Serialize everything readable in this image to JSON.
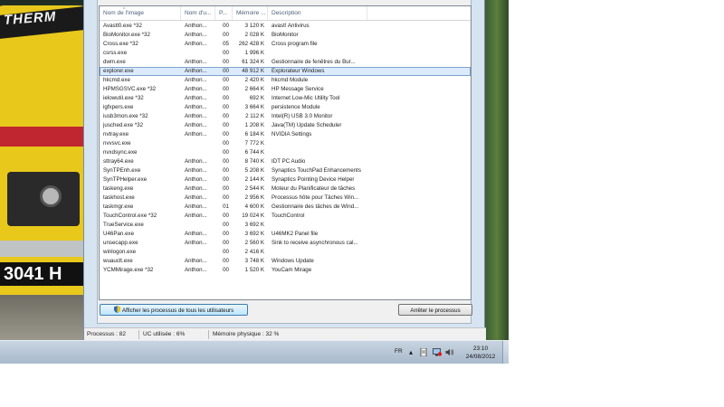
{
  "wallpaper": {
    "brand_text": "THERM",
    "plate_text": "3041 H"
  },
  "columns": [
    "Nom de l'image",
    "Nom d'u...",
    "P...",
    "Mémoire ...",
    "Description"
  ],
  "processes": [
    [
      "Avastl0.exe *32",
      "Anthon...",
      "00",
      "3 120 K",
      "avast! Antivirus"
    ],
    [
      "BioMonitor.exe *32",
      "Anthon...",
      "00",
      "2 028 K",
      "BioMonitor"
    ],
    [
      "Cross.exe *32",
      "Anthon...",
      "05",
      "262 428 K",
      "Cross program file"
    ],
    [
      "csrss.exe",
      "",
      "00",
      "1 996 K",
      ""
    ],
    [
      "dwm.exe",
      "Anthon...",
      "00",
      "61 324 K",
      "Gestionnaire de fenêtres du Bur..."
    ],
    [
      "explorer.exe",
      "Anthon...",
      "00",
      "48 912 K",
      "Explorateur Windows"
    ],
    [
      "hkcmd.exe",
      "Anthon...",
      "00",
      "2 420 K",
      "hkcmd Module"
    ],
    [
      "HPMSGSVC.exe *32",
      "Anthon...",
      "00",
      "2 664 K",
      "HP Message Service"
    ],
    [
      "ielowutil.exe *32",
      "Anthon...",
      "00",
      "692 K",
      "Internet Low-Mic Utility Tool"
    ],
    [
      "igfxpers.exe",
      "Anthon...",
      "00",
      "3 664 K",
      "persistence Module"
    ],
    [
      "iusb3mon.exe *32",
      "Anthon...",
      "00",
      "2 112 K",
      "Intel(R) USB 3.0 Monitor"
    ],
    [
      "jusched.exe *32",
      "Anthon...",
      "00",
      "1 208 K",
      "Java(TM) Update Scheduler"
    ],
    [
      "nvtray.exe",
      "Anthon...",
      "00",
      "6 184 K",
      "NVIDIA Settings"
    ],
    [
      "nvvsvc.exe",
      "",
      "00",
      "7 772 K",
      ""
    ],
    [
      "nvxdsync.exe",
      "",
      "00",
      "6 744 K",
      ""
    ],
    [
      "sttray64.exe",
      "Anthon...",
      "00",
      "8 740 K",
      "IDT PC Audio"
    ],
    [
      "SynTPEnh.exe",
      "Anthon...",
      "00",
      "5 208 K",
      "Synaptics TouchPad Enhancements"
    ],
    [
      "SynTPHelper.exe",
      "Anthon...",
      "00",
      "2 144 K",
      "Synaptics Pointing Device Helper"
    ],
    [
      "taskeng.exe",
      "Anthon...",
      "00",
      "2 544 K",
      "Moteur du Planificateur de tâches"
    ],
    [
      "taskhost.exe",
      "Anthon...",
      "00",
      "2 956 K",
      "Processus hôte pour Tâches Win..."
    ],
    [
      "taskmgr.exe",
      "Anthon...",
      "01",
      "4 600 K",
      "Gestionnaire des tâches de Wind..."
    ],
    [
      "TouchControl.exe *32",
      "Anthon...",
      "00",
      "19 024 K",
      "TouchControl"
    ],
    [
      "TrueService.exe",
      "",
      "00",
      "3 692 K",
      ""
    ],
    [
      "U46Pan.exe",
      "Anthon...",
      "00",
      "3 692 K",
      "U46MK2 Panel file"
    ],
    [
      "unsecapp.exe",
      "Anthon...",
      "00",
      "2 560 K",
      "Sink to receive asynchronous cal..."
    ],
    [
      "winlogon.exe",
      "",
      "00",
      "2 416 K",
      ""
    ],
    [
      "wuauclt.exe",
      "Anthon...",
      "00",
      "3 748 K",
      "Windows Update"
    ],
    [
      "YCMMirage.exe *32",
      "Anthon...",
      "00",
      "1 520 K",
      "YouCam Mirage"
    ]
  ],
  "selected_index": 5,
  "buttons": {
    "show_all": "Afficher les processus de tous les utilisateurs",
    "end_process": "Arrêter le processus"
  },
  "status": {
    "processes": "Processus : 82",
    "cpu": "UC utilisée : 6%",
    "memory": "Mémoire physique : 32 %"
  },
  "taskbar": {
    "language": "FR",
    "time": "23:10",
    "date": "24/08/2012",
    "tray_icons": [
      "show-hidden-icon",
      "action-center-icon",
      "network-icon",
      "volume-icon"
    ]
  },
  "colors": {
    "selection": "#dcebfc",
    "selection_border": "#7da2ce",
    "window_frame": "#d6e4f1",
    "taskbar": "#b8c7d6"
  }
}
